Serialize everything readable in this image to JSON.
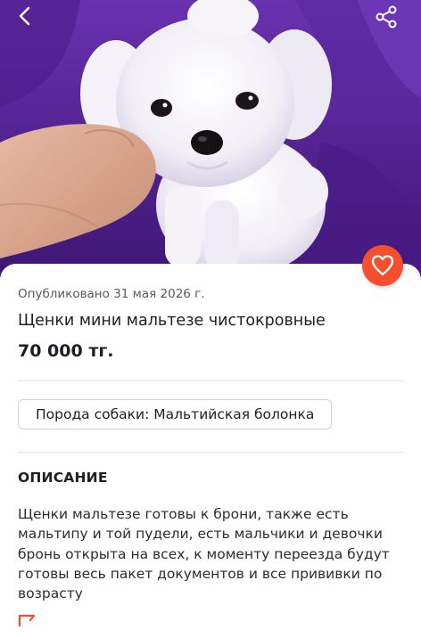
{
  "listing": {
    "published": "Опубликовано 31 мая 2026 г.",
    "title": "Щенки мини мальтезе чистокровные",
    "price": "70 000 тг.",
    "tag": "Порода собаки: Мальтийская болонка"
  },
  "description": {
    "heading": "ОПИСАНИЕ",
    "text": "Щенки мальтезе готовы к брони, также есть мальтипу и той пудели, есть мальчики и девочки бронь открыта на всех, к моменту переезда будут готовы весь пакет документов и все прививки по возрасту"
  },
  "icons": {
    "back": "chevron-left-icon",
    "share": "share-icon",
    "favorite": "heart-icon",
    "report": "flag-icon"
  },
  "colors": {
    "accent": "#f5502d",
    "photo_background": "#5a2a9c"
  }
}
